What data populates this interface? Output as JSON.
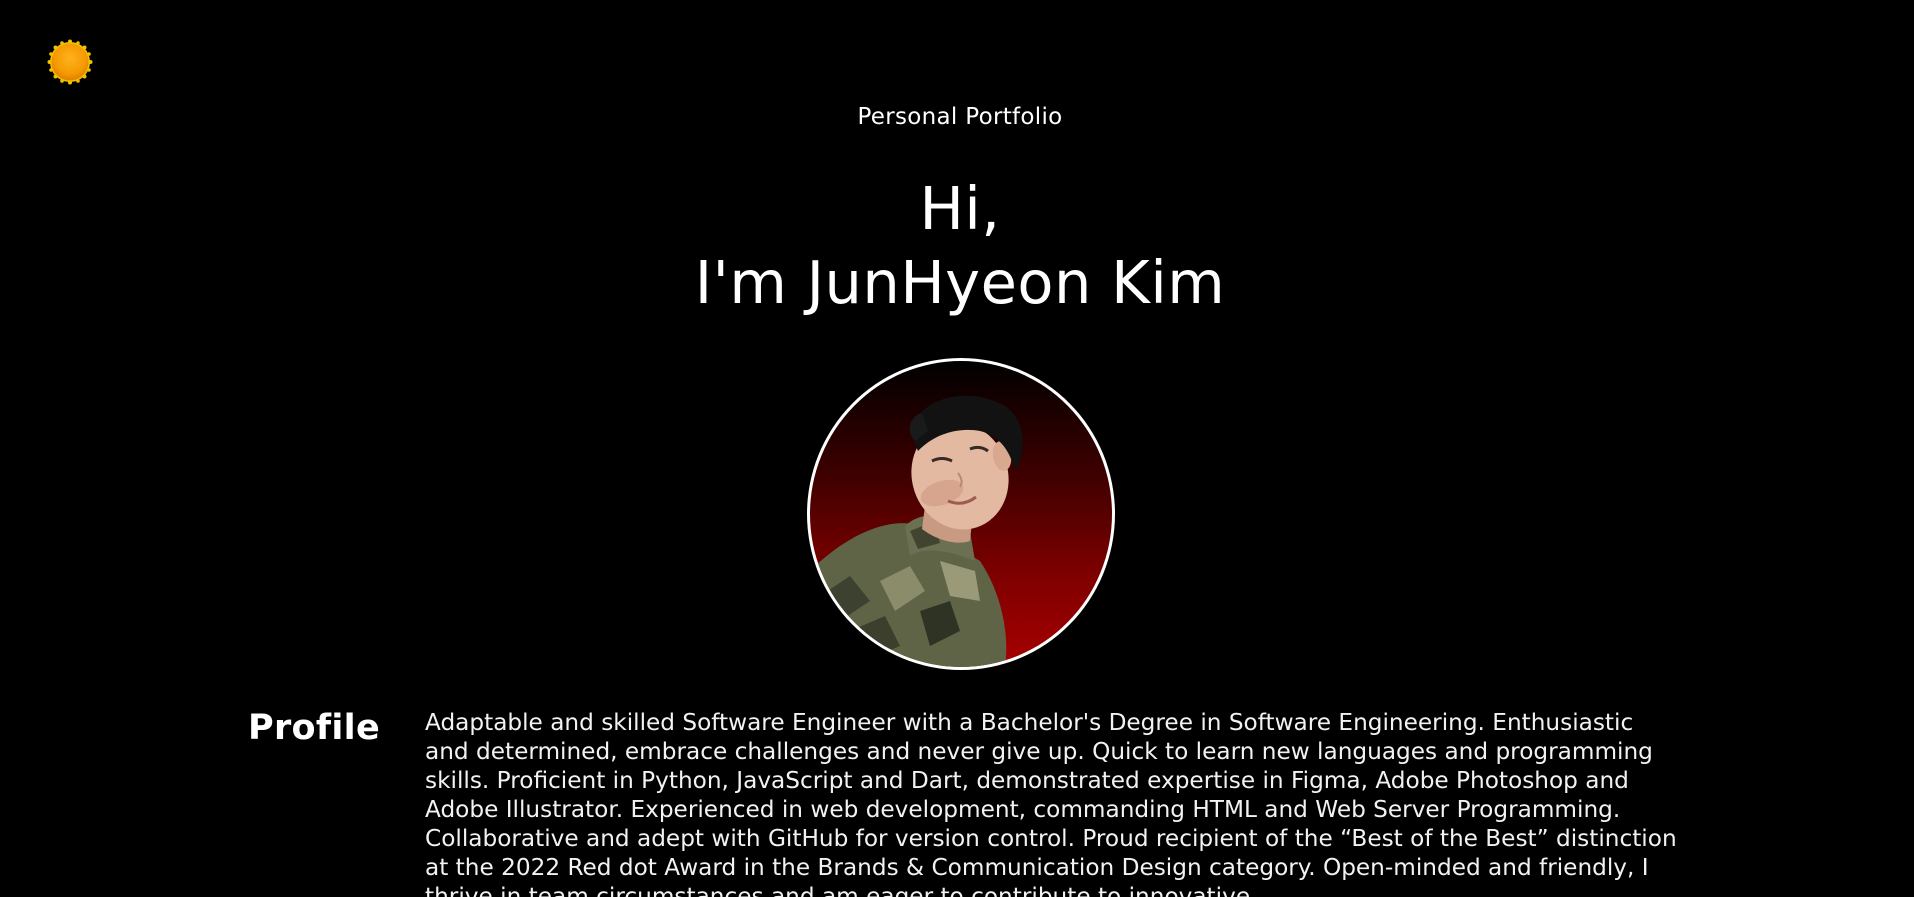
{
  "theme_toggle": {
    "icon": "sun-icon",
    "color": "#f5a800"
  },
  "header": {
    "subtitle": "Personal Portfolio",
    "greeting": "Hi,",
    "name_line": "I'm JunHyeon Kim"
  },
  "avatar": {
    "border_color": "#ffffff",
    "background_color": "#a70000"
  },
  "profile": {
    "heading": "Profile",
    "text": "Adaptable and skilled Software Engineer with a Bachelor's Degree in Software Engineering. Enthusiastic and determined, embrace challenges and never give up. Quick to learn new languages and programming skills. Proficient in Python, JavaScript and Dart, demonstrated expertise in Figma, Adobe Photoshop and Adobe Illustrator. Experienced in web development, commanding HTML and Web Server Programming. Collaborative and adept with GitHub for version control. Proud recipient of the “Best of the Best” distinction at the 2022 Red dot Award in the Brands & Communication Design category. Open-minded and friendly, I thrive in team circumstances and am eager to contribute to innovative"
  }
}
